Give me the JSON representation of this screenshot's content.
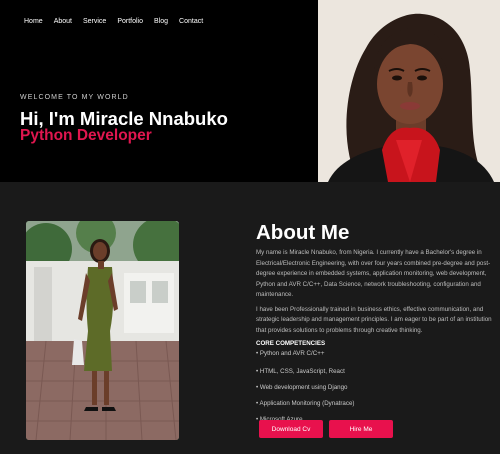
{
  "nav": {
    "items": [
      "Home",
      "About",
      "Service",
      "Portfolio",
      "Blog",
      "Contact"
    ]
  },
  "hero": {
    "welcome": "WELCOME TO MY WORLD",
    "title": "Hi, I'm Miracle Nnabuko",
    "role": "Python Developer",
    "accent_color": "#e0164f"
  },
  "about": {
    "heading": "About Me",
    "paragraph1": "My name is Miracle Nnabuko, from Nigeria. I currently have a Bachelor's degree in Electrical/Electronic Engineering, with over four years combined pre-degree and post-degree experience in embedded systems, application monitoring, web development, Python and AVR C/C++, Data Science, network troubleshooting, configuration and maintenance.",
    "paragraph2": "I have been Professionally trained in business ethics, effective communication, and strategic leadership and management principles. I am eager to be part of an institution that provides solutions to problems through creative thinking.",
    "competencies_heading": "CORE COMPETENCIES",
    "competencies": [
      "• Python and AVR C/C++",
      "• HTML, CSS, JavaScript, React",
      "• Web development using Django",
      "• Application Monitoring (Dynatrace)",
      "• Microsoft Azure"
    ]
  },
  "buttons": {
    "download_cv": "Download Cv",
    "hire_me": "Hire Me"
  }
}
